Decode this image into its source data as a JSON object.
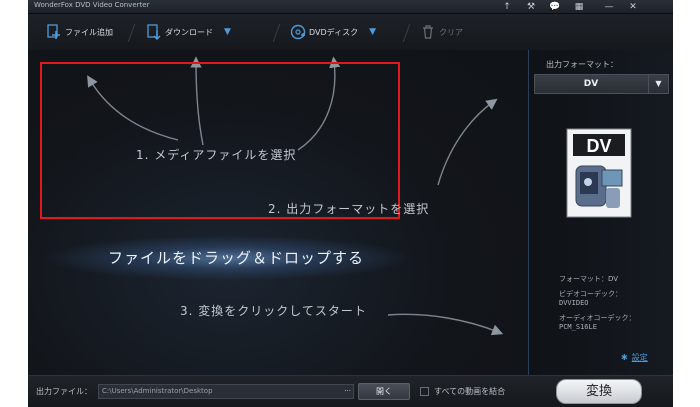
{
  "window": {
    "title": "WonderFox DVD Video Converter",
    "controls": [
      "↑",
      "⚒",
      "💬",
      "▦",
      "—",
      "✕"
    ]
  },
  "toolbar": {
    "add_file": "ファイル追加",
    "download": "ダウンロード",
    "dvd_disc": "DVDディスク",
    "clear": "クリア"
  },
  "steps": {
    "step1": "1. メディアファイルを選択",
    "step2": "2. 出力フォーマットを選択",
    "step3": "3. 変換をクリックしてスタート"
  },
  "drop_hint": "ファイルをドラッグ＆ドロップする",
  "output_panel": {
    "format_label": "出力フォーマット：",
    "selected_format": "DV",
    "icon_label": "DV",
    "info": {
      "format": "フォーマット：DV",
      "video_codec_label": "ビデオコーデック：",
      "video_codec": "DVVIDEO",
      "audio_codec_label": "オーディオコーデック：",
      "audio_codec": "PCM_S16LE"
    },
    "settings_label": "設定"
  },
  "bottom_bar": {
    "output_file_label": "出力ファイル：",
    "output_path": "C:\\Users\\Administrator\\Desktop",
    "browse": "···",
    "open_button": "開く",
    "merge_label": "すべての動画を結合",
    "convert_button": "変換"
  },
  "colors": {
    "accent": "#4f9ad8",
    "highlight_box": "#e01919",
    "background": "#14171c"
  }
}
